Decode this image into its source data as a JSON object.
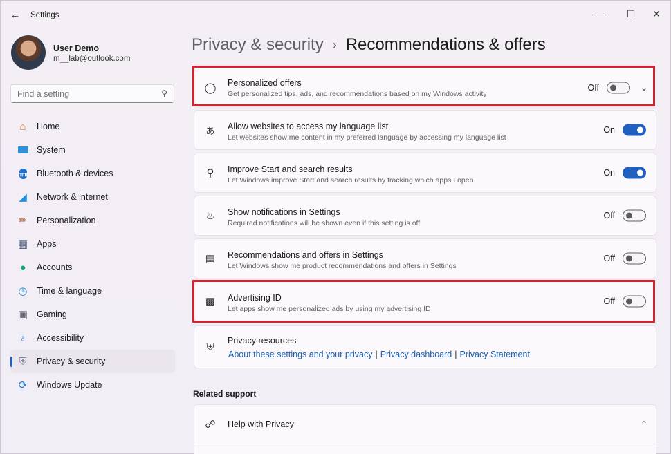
{
  "window": {
    "title": "Settings",
    "controls": [
      "minimize",
      "maximize",
      "close"
    ]
  },
  "user": {
    "name": "User Demo",
    "email": "m__lab@outlook.com"
  },
  "search": {
    "placeholder": "Find a setting"
  },
  "nav": [
    {
      "label": "Home",
      "icon": "home-icon"
    },
    {
      "label": "System",
      "icon": "monitor-icon"
    },
    {
      "label": "Bluetooth & devices",
      "icon": "bluetooth-icon"
    },
    {
      "label": "Network & internet",
      "icon": "wifi-icon"
    },
    {
      "label": "Personalization",
      "icon": "brush-icon"
    },
    {
      "label": "Apps",
      "icon": "apps-icon"
    },
    {
      "label": "Accounts",
      "icon": "person-icon"
    },
    {
      "label": "Time & language",
      "icon": "clock-globe-icon"
    },
    {
      "label": "Gaming",
      "icon": "gamepad-icon"
    },
    {
      "label": "Accessibility",
      "icon": "accessibility-icon"
    },
    {
      "label": "Privacy & security",
      "icon": "shield-icon",
      "active": true
    },
    {
      "label": "Windows Update",
      "icon": "update-icon"
    }
  ],
  "breadcrumb": {
    "parent": "Privacy & security",
    "separator": "›",
    "current": "Recommendations & offers"
  },
  "settings": [
    {
      "title": "Personalized offers",
      "desc": "Get personalized tips, ads, and recommendations based on my Windows activity",
      "state": "Off",
      "on": false,
      "icon": "lightbulb-icon",
      "expandable": true,
      "highlighted": true
    },
    {
      "title": "Allow websites to access my language list",
      "desc": "Let websites show me content in my preferred language by accessing my language list",
      "state": "On",
      "on": true,
      "icon": "language-icon"
    },
    {
      "title": "Improve Start and search results",
      "desc": "Let Windows improve Start and search results by tracking which apps I open",
      "state": "On",
      "on": true,
      "icon": "search-icon"
    },
    {
      "title": "Show notifications in Settings",
      "desc": "Required notifications will be shown even if this setting is off",
      "state": "Off",
      "on": false,
      "icon": "bell-icon"
    },
    {
      "title": "Recommendations and offers in Settings",
      "desc": "Let Windows show me product recommendations and offers in Settings",
      "state": "Off",
      "on": false,
      "icon": "offers-icon"
    },
    {
      "title": "Advertising ID",
      "desc": "Let apps show me personalized ads by using my advertising ID",
      "state": "Off",
      "on": false,
      "icon": "id-badge-icon",
      "highlighted": true
    }
  ],
  "privacy_resources": {
    "title": "Privacy resources",
    "links": [
      "About these settings and your privacy",
      "Privacy dashboard",
      "Privacy Statement"
    ],
    "separator": "|",
    "icon": "shield-outline-icon"
  },
  "related_support": {
    "heading": "Related support",
    "item": "Help with Privacy",
    "icon": "globe-help-icon"
  },
  "colors": {
    "accent": "#1f5fbf",
    "highlight": "#d3232f",
    "link": "#1a5fb4"
  }
}
